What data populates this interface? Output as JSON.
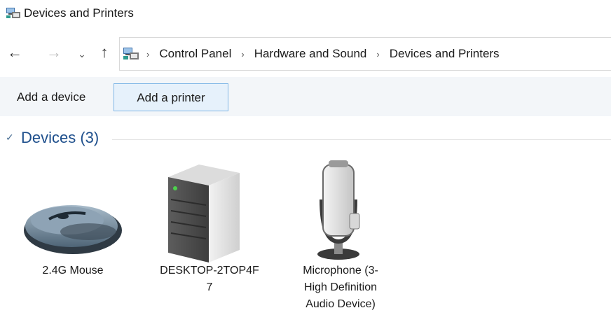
{
  "window": {
    "title": "Devices and Printers",
    "icon": "devices-and-printers-icon"
  },
  "navigation": {
    "back_icon": "arrow-left-icon",
    "forward_icon": "arrow-right-icon",
    "recent_icon": "chevron-down-icon",
    "up_icon": "arrow-up-icon",
    "address_icon": "control-panel-icon",
    "breadcrumbs": [
      "Control Panel",
      "Hardware and Sound",
      "Devices and Printers"
    ]
  },
  "commands": {
    "add_device": "Add a device",
    "add_printer": "Add a printer"
  },
  "group": {
    "title": "Devices (3)",
    "expanded": true
  },
  "devices": [
    {
      "label": "2.4G Mouse",
      "icon": "mouse-icon"
    },
    {
      "label": "DESKTOP-2TOP4F\n7",
      "icon": "computer-tower-icon"
    },
    {
      "label": "Microphone (3-\nHigh Definition\nAudio Device)",
      "icon": "microphone-icon"
    }
  ],
  "colors": {
    "accent_blue": "#1e4f8c",
    "selected_border": "#7fb6e6",
    "selected_fill": "#e6f1fb",
    "command_bar": "#f3f6f9"
  }
}
